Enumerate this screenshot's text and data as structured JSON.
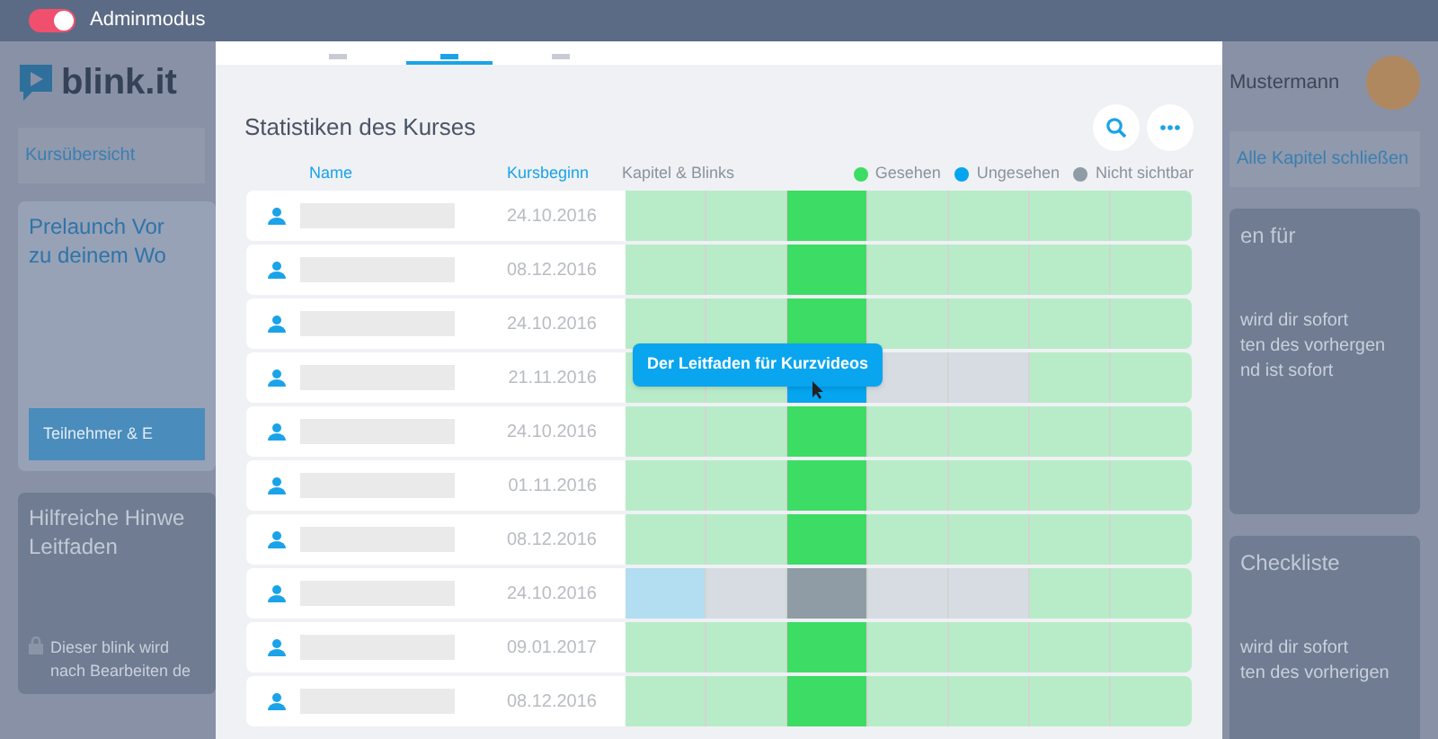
{
  "top_bar": {
    "admin_toggle": {
      "label": "Adminmodus",
      "on": true
    }
  },
  "background_page": {
    "logo": "blink.it",
    "back_link": "Kursübersicht",
    "user_name": "Mustermann",
    "collapse_link": "Alle Kapitel schließen",
    "left_cards": [
      {
        "title": "Prelaunch Vor\nzu deinem Wo",
        "button": "Teilnehmer & E",
        "locked": false
      },
      {
        "title": "Hilfreiche Hinwe\nLeitfaden",
        "locked": true,
        "text": "Dieser blink wird\nnach Bearbeiten de"
      }
    ],
    "right_cards": [
      {
        "title": "en für",
        "text": "wird dir sofort\nten des vorhergen\nnd ist sofort"
      },
      {
        "title": "Checkliste",
        "text": "wird dir sofort\nten des vorherigen"
      }
    ]
  },
  "modal": {
    "tabs": [
      {
        "selected": false
      },
      {
        "selected": true
      },
      {
        "selected": false
      }
    ],
    "title": "Statistiken des Kurses",
    "columns": {
      "name": "Name",
      "start": "Kursbeginn",
      "chapters": "Kapitel & Blinks"
    },
    "legend": [
      {
        "label": "Gesehen",
        "color": "#3ddc64"
      },
      {
        "label": "Ungesehen",
        "color": "#05a5f0"
      },
      {
        "label": "Nicht sichtbar",
        "color": "#8f9ca6"
      }
    ],
    "chapter_columns": [
      {
        "highlighted": false
      },
      {
        "highlighted": false
      },
      {
        "highlighted": true
      },
      {
        "highlighted": false
      },
      {
        "highlighted": false
      },
      {
        "highlighted": false
      },
      {
        "highlighted": false
      }
    ],
    "rows": [
      {
        "date": "24.10.2016",
        "cells": [
          {
            "visible": true,
            "seen": true
          },
          {
            "visible": true,
            "seen": true
          },
          {
            "visible": true,
            "seen": true
          },
          {
            "visible": true,
            "seen": true
          },
          {
            "visible": true,
            "seen": true
          },
          {
            "visible": true,
            "seen": true
          },
          {
            "visible": true,
            "seen": true
          }
        ]
      },
      {
        "date": "08.12.2016",
        "cells": [
          {
            "visible": true,
            "seen": true
          },
          {
            "visible": true,
            "seen": true
          },
          {
            "visible": true,
            "seen": true
          },
          {
            "visible": true,
            "seen": true
          },
          {
            "visible": true,
            "seen": true
          },
          {
            "visible": true,
            "seen": true
          },
          {
            "visible": true,
            "seen": true
          }
        ]
      },
      {
        "date": "24.10.2016",
        "cells": [
          {
            "visible": true,
            "seen": true
          },
          {
            "visible": true,
            "seen": true
          },
          {
            "visible": true,
            "seen": true
          },
          {
            "visible": true,
            "seen": true
          },
          {
            "visible": true,
            "seen": true
          },
          {
            "visible": true,
            "seen": true
          },
          {
            "visible": true,
            "seen": true
          }
        ]
      },
      {
        "date": "21.11.2016",
        "tooltip": "Der Leitfaden für Kurzvideos",
        "cells": [
          {
            "visible": true,
            "seen": true
          },
          {
            "visible": true,
            "seen": true
          },
          {
            "visible": true,
            "seen": false
          },
          {
            "visible": false
          },
          {
            "visible": false
          },
          {
            "visible": true,
            "seen": true
          },
          {
            "visible": true,
            "seen": true
          }
        ]
      },
      {
        "date": "24.10.2016",
        "cells": [
          {
            "visible": true,
            "seen": true
          },
          {
            "visible": true,
            "seen": true
          },
          {
            "visible": true,
            "seen": true
          },
          {
            "visible": true,
            "seen": true
          },
          {
            "visible": true,
            "seen": true
          },
          {
            "visible": true,
            "seen": true
          },
          {
            "visible": true,
            "seen": true
          }
        ]
      },
      {
        "date": "01.11.2016",
        "cells": [
          {
            "visible": true,
            "seen": true
          },
          {
            "visible": true,
            "seen": true
          },
          {
            "visible": true,
            "seen": true
          },
          {
            "visible": true,
            "seen": true
          },
          {
            "visible": true,
            "seen": true
          },
          {
            "visible": true,
            "seen": true
          },
          {
            "visible": true,
            "seen": true
          }
        ]
      },
      {
        "date": "08.12.2016",
        "cells": [
          {
            "visible": true,
            "seen": true
          },
          {
            "visible": true,
            "seen": true
          },
          {
            "visible": true,
            "seen": true
          },
          {
            "visible": true,
            "seen": true
          },
          {
            "visible": true,
            "seen": true
          },
          {
            "visible": true,
            "seen": true
          },
          {
            "visible": true,
            "seen": true
          }
        ]
      },
      {
        "date": "24.10.2016",
        "cells": [
          {
            "visible": true,
            "seen": false
          },
          {
            "visible": false
          },
          {
            "visible": false
          },
          {
            "visible": false
          },
          {
            "visible": false
          },
          {
            "visible": true,
            "seen": true
          },
          {
            "visible": true,
            "seen": true
          }
        ]
      },
      {
        "date": "09.01.2017",
        "cells": [
          {
            "visible": true,
            "seen": true
          },
          {
            "visible": true,
            "seen": true
          },
          {
            "visible": true,
            "seen": true
          },
          {
            "visible": true,
            "seen": true
          },
          {
            "visible": true,
            "seen": true
          },
          {
            "visible": true,
            "seen": true
          },
          {
            "visible": true,
            "seen": true
          }
        ]
      },
      {
        "date": "08.12.2016",
        "cells": [
          {
            "visible": true,
            "seen": true
          },
          {
            "visible": true,
            "seen": true
          },
          {
            "visible": true,
            "seen": true
          },
          {
            "visible": true,
            "seen": true
          },
          {
            "visible": true,
            "seen": true
          },
          {
            "visible": true,
            "seen": true
          },
          {
            "visible": true,
            "seen": true
          }
        ]
      }
    ]
  }
}
